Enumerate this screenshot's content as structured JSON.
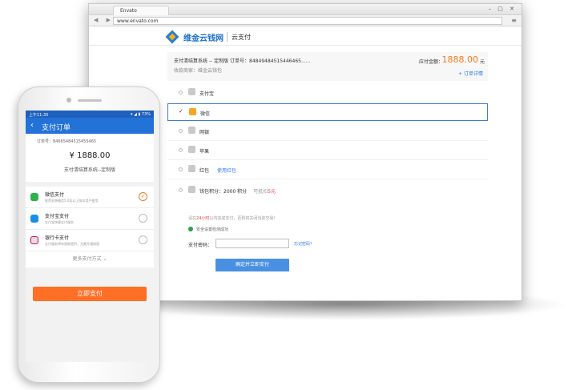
{
  "browser": {
    "tab_title": "Envato",
    "window_buttons": "– ▢ ✕",
    "url": "www.envato.com"
  },
  "site": {
    "logo_text": "维金云钱网",
    "sub_title": "云支付"
  },
  "order": {
    "line1": "支付清结算系统 -- 定制版   订单号：84849484515446465......",
    "line2": "收款商家：维金云钱包",
    "amount_label": "应付金额：",
    "amount_value": "1888.00",
    "amount_unit": "元",
    "detail_link": "+ 订单详情"
  },
  "methods": [
    {
      "label": "支付宝"
    },
    {
      "label": "微信",
      "selected": true
    },
    {
      "label": "网银"
    },
    {
      "label": "苹果"
    },
    {
      "label": "红包",
      "link": "使用红包"
    },
    {
      "label": "钱包积分：2000 积分",
      "extra_prefix": "可抵扣",
      "extra_value": "5元"
    }
  ],
  "tip": {
    "prefix": "请在",
    "highlight": "24小时",
    "suffix": "以内完成支付，否则将关闭当前交易！"
  },
  "safe_text": "安全设置检测成功",
  "pwd": {
    "label": "支付密码：",
    "forgot": "忘记密码？"
  },
  "pay_button": "确定并立即支付",
  "phone": {
    "status_left": "上午11:35",
    "status_right": "▾ ◢ ▮ 73%",
    "back": "‹",
    "title": "支付订单",
    "order_no": "订单号：84665484515455465",
    "amount": "¥ 1888.00",
    "desc": "支付清结算系统--定制版",
    "methods": [
      {
        "name": "微信支付",
        "sub": "推荐安装微信5.0及以上版本用户使用",
        "selected": true
      },
      {
        "name": "支付宝支付",
        "sub": "支付宝快捷支付服务",
        "selected": false
      },
      {
        "name": "银行卡支付",
        "sub": "支付服务将有银联提供，无需开通网银",
        "selected": false
      }
    ],
    "more": "更多支付方式 ⌄",
    "pay": "立即支付"
  }
}
